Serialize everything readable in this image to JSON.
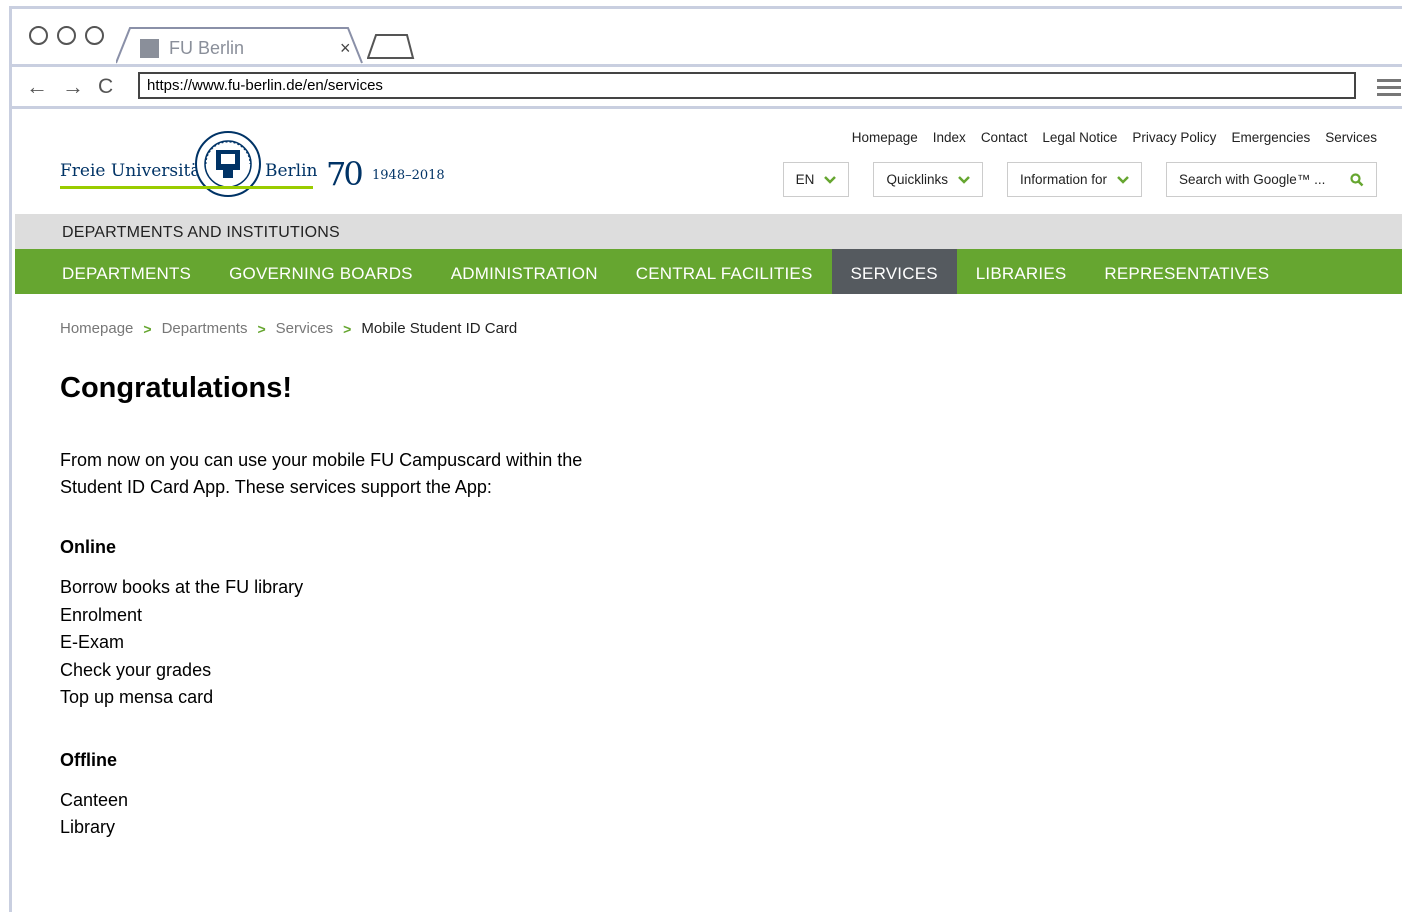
{
  "browser": {
    "tab_title": "FU Berlin",
    "tab_close": "×",
    "url": "https://www.fu-berlin.de/en/services"
  },
  "logo": {
    "name_left": "Freie Universität",
    "name_right": "Berlin",
    "anniversary": "70",
    "years": "1948–2018"
  },
  "service_links": [
    "Homepage",
    "Index",
    "Contact",
    "Legal Notice",
    "Privacy Policy",
    "Emergencies",
    "Services"
  ],
  "controls": {
    "language": "EN",
    "quicklinks": "Quicklinks",
    "information_for": "Information for",
    "search_placeholder": "Search with Google™ ..."
  },
  "section_title": "DEPARTMENTS AND INSTITUTIONS",
  "nav": [
    "DEPARTMENTS",
    "GOVERNING BOARDS",
    "ADMINISTRATION",
    "CENTRAL FACILITIES",
    "SERVICES",
    "LIBRARIES",
    "REPRESENTATIVES"
  ],
  "nav_active": "SERVICES",
  "breadcrumb": [
    "Homepage",
    "Departments",
    "Services",
    "Mobile Student ID Card"
  ],
  "content": {
    "heading": "Congratulations!",
    "intro_line1": "From now on you can use your mobile FU Campuscard within the",
    "intro_line2": "Student ID Card App. These services support the App:",
    "online_heading": "Online",
    "online_items": [
      "Borrow books at the FU library",
      "Enrolment",
      "E-Exam",
      "Check your grades",
      "Top up mensa card"
    ],
    "offline_heading": "Offline",
    "offline_items": [
      "Canteen",
      "Library"
    ]
  },
  "colors": {
    "green": "#66a630",
    "active_nav": "#555a5f",
    "logo_blue": "#003366",
    "logo_underline": "#99cc00"
  }
}
